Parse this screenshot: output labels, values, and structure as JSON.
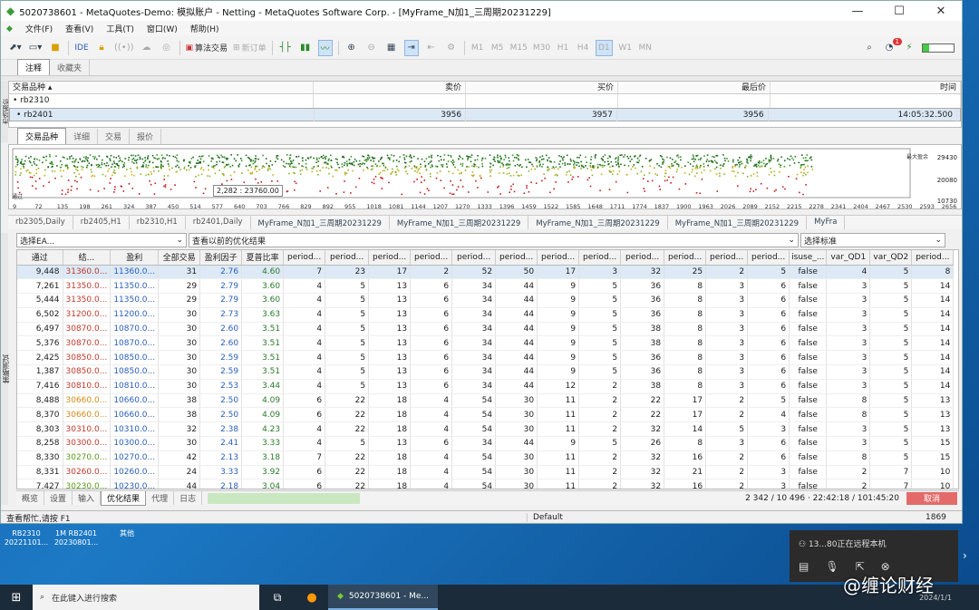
{
  "window": {
    "title": "5020738601 - MetaQuotes-Demo: 模拟账户 - Netting - MetaQuotes Software Corp. - [MyFrame_N加1_三周期20231229]"
  },
  "menu": [
    "文件(F)",
    "查看(V)",
    "工具(T)",
    "窗口(W)",
    "帮助(H)"
  ],
  "toolbar": {
    "ide": "IDE",
    "algo": "算法交易",
    "new_order": "新订单",
    "timeframes": [
      "M1",
      "M5",
      "M15",
      "M30",
      "H1",
      "H4",
      "D1",
      "W1",
      "MN"
    ],
    "active_tf": "D1",
    "notif_count": "1"
  },
  "navigator_tabs": [
    "注释",
    "收藏夹"
  ],
  "market_watch": {
    "side_label": "市场报价",
    "headers": [
      "交易品种",
      "卖价",
      "买价",
      "最后价",
      "时间"
    ],
    "rows": [
      {
        "symbol": "rb2310",
        "bid": "",
        "ask": "",
        "last": "",
        "time": ""
      },
      {
        "symbol": "rb2401",
        "bid": "3956",
        "ask": "3957",
        "last": "3956",
        "time": "14:05:32.500"
      }
    ],
    "tabs": [
      "交易品种",
      "详细",
      "交易",
      "报价"
    ]
  },
  "chart": {
    "y_labels": [
      "29430",
      "20080",
      "10730"
    ],
    "top_label": "最大盈余",
    "left_label": "通过",
    "tooltip": "2,282 : 23760.00",
    "x_labels": [
      "9",
      "72",
      "135",
      "198",
      "261",
      "324",
      "387",
      "450",
      "514",
      "577",
      "640",
      "703",
      "766",
      "829",
      "892",
      "955",
      "1018",
      "1081",
      "1144",
      "1207",
      "1270",
      "1333",
      "1396",
      "1459",
      "1522",
      "1585",
      "1648",
      "1711",
      "1774",
      "1837",
      "1900",
      "1963",
      "2026",
      "2089",
      "2152",
      "2215",
      "2278",
      "2341",
      "2404",
      "2467",
      "2530",
      "2593",
      "2656"
    ]
  },
  "chart_tabs": [
    "rb2305,Daily",
    "rb2405,H1",
    "rb2310,H1",
    "rb2401,Daily",
    "MyFrame_N加1_三周期20231229",
    "MyFrame_N加1_三周期20231229",
    "MyFrame_N加1_三周期20231229",
    "MyFrame_N加1_三周期20231229",
    "MyFra"
  ],
  "tester": {
    "side_label": "策略测试",
    "select_ea": "选择EA...",
    "view_prev": "查看以前的优化结果",
    "select_std": "选择标准",
    "headers": [
      "通过",
      "结...",
      "盈利",
      "全部交易",
      "盈利因子",
      "夏普比率",
      "period...",
      "period...",
      "period...",
      "period...",
      "period...",
      "period...",
      "period...",
      "period...",
      "period...",
      "period...",
      "period...",
      "period...",
      "isuse_...",
      "var_QD1",
      "var_QD2",
      "period..."
    ],
    "rows": [
      [
        "9,448",
        "31360.0...",
        "11360.0...",
        "31",
        "2.76",
        "4.60",
        "7",
        "23",
        "17",
        "2",
        "52",
        "50",
        "17",
        "3",
        "32",
        "25",
        "2",
        "5",
        "false",
        "4",
        "5",
        "8"
      ],
      [
        "7,261",
        "31350.0...",
        "11350.0...",
        "29",
        "2.79",
        "3.60",
        "4",
        "5",
        "13",
        "6",
        "34",
        "44",
        "9",
        "5",
        "36",
        "8",
        "3",
        "6",
        "false",
        "3",
        "5",
        "14"
      ],
      [
        "5,444",
        "31350.0...",
        "11350.0...",
        "29",
        "2.79",
        "3.60",
        "4",
        "5",
        "13",
        "6",
        "34",
        "44",
        "9",
        "5",
        "36",
        "8",
        "3",
        "6",
        "false",
        "3",
        "5",
        "14"
      ],
      [
        "6,502",
        "31200.0...",
        "11200.0...",
        "30",
        "2.73",
        "3.63",
        "4",
        "5",
        "13",
        "6",
        "34",
        "44",
        "9",
        "5",
        "36",
        "8",
        "3",
        "6",
        "false",
        "3",
        "5",
        "14"
      ],
      [
        "6,497",
        "30870.0...",
        "10870.0...",
        "30",
        "2.60",
        "3.51",
        "4",
        "5",
        "13",
        "6",
        "34",
        "44",
        "9",
        "5",
        "38",
        "8",
        "3",
        "6",
        "false",
        "3",
        "5",
        "14"
      ],
      [
        "5,376",
        "30870.0...",
        "10870.0...",
        "30",
        "2.60",
        "3.51",
        "4",
        "5",
        "13",
        "6",
        "34",
        "44",
        "9",
        "5",
        "38",
        "8",
        "3",
        "6",
        "false",
        "3",
        "5",
        "14"
      ],
      [
        "2,425",
        "30850.0...",
        "10850.0...",
        "30",
        "2.59",
        "3.51",
        "4",
        "5",
        "13",
        "6",
        "34",
        "44",
        "9",
        "5",
        "36",
        "8",
        "3",
        "6",
        "false",
        "3",
        "5",
        "14"
      ],
      [
        "1,387",
        "30850.0...",
        "10850.0...",
        "30",
        "2.59",
        "3.51",
        "4",
        "5",
        "13",
        "6",
        "34",
        "44",
        "9",
        "5",
        "36",
        "8",
        "3",
        "6",
        "false",
        "3",
        "5",
        "14"
      ],
      [
        "7,416",
        "30810.0...",
        "10810.0...",
        "30",
        "2.53",
        "3.44",
        "4",
        "5",
        "13",
        "6",
        "34",
        "44",
        "12",
        "2",
        "38",
        "8",
        "3",
        "6",
        "false",
        "3",
        "5",
        "14"
      ],
      [
        "8,488",
        "30660.0...",
        "10660.0...",
        "38",
        "2.50",
        "4.09",
        "6",
        "22",
        "18",
        "4",
        "54",
        "30",
        "11",
        "2",
        "22",
        "17",
        "2",
        "5",
        "false",
        "8",
        "5",
        "13"
      ],
      [
        "8,370",
        "30660.0...",
        "10660.0...",
        "38",
        "2.50",
        "4.09",
        "6",
        "22",
        "18",
        "4",
        "54",
        "30",
        "11",
        "2",
        "22",
        "17",
        "2",
        "4",
        "false",
        "8",
        "5",
        "13"
      ],
      [
        "8,303",
        "30310.0...",
        "10310.0...",
        "32",
        "2.38",
        "4.23",
        "4",
        "22",
        "18",
        "4",
        "54",
        "30",
        "11",
        "2",
        "32",
        "14",
        "5",
        "3",
        "false",
        "3",
        "5",
        "13"
      ],
      [
        "8,258",
        "30300.0...",
        "10300.0...",
        "30",
        "2.41",
        "3.33",
        "4",
        "5",
        "13",
        "6",
        "34",
        "44",
        "9",
        "5",
        "26",
        "8",
        "3",
        "6",
        "false",
        "3",
        "5",
        "15"
      ],
      [
        "8,330",
        "30270.0...",
        "10270.0...",
        "42",
        "2.13",
        "3.18",
        "7",
        "22",
        "18",
        "4",
        "54",
        "30",
        "11",
        "2",
        "32",
        "16",
        "2",
        "6",
        "false",
        "8",
        "5",
        "15"
      ],
      [
        "8,331",
        "30260.0...",
        "10260.0...",
        "24",
        "3.33",
        "3.92",
        "6",
        "22",
        "18",
        "4",
        "54",
        "30",
        "11",
        "2",
        "32",
        "21",
        "2",
        "3",
        "false",
        "2",
        "7",
        "10"
      ],
      [
        "7,427",
        "30230.0...",
        "10230.0...",
        "44",
        "2.18",
        "3.04",
        "6",
        "22",
        "18",
        "4",
        "54",
        "30",
        "11",
        "2",
        "32",
        "16",
        "2",
        "3",
        "false",
        "2",
        "7",
        "10"
      ]
    ],
    "bottom_tabs": [
      "概览",
      "设置",
      "输入",
      "优化结果",
      "代理",
      "日志"
    ],
    "active_bottom_tab": "优化结果",
    "status": "2 342 / 10 496  ·  22:42:18 / 101:45:20",
    "cancel": "取消"
  },
  "statusbar": {
    "help": "查看帮忙,请按 F1",
    "profile": "Default",
    "count": "1869"
  },
  "desktop_icons": [
    {
      "l1": "RB2310",
      "l2": "20221101..."
    },
    {
      "l1": "1M RB2401",
      "l2": "20230801..."
    },
    {
      "l1": "其他",
      "l2": ""
    }
  ],
  "notification": {
    "text": "13...80正在远程本机"
  },
  "taskbar": {
    "search": "在此键入进行搜索",
    "app": "5020738601 - Me...",
    "date": "2024/1/1"
  },
  "watermark": "@缠论财经",
  "colors": {
    "profit_red": "#c0392b",
    "profit_orange": "#d08a1a",
    "profit_green": "#5a9a1a",
    "profit_blue": "#2a5fb8"
  }
}
